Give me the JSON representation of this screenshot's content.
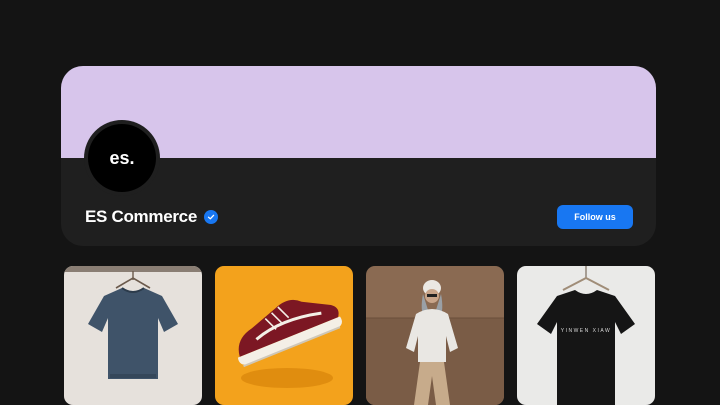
{
  "theme": {
    "background": "#141414",
    "card": "#1f1f1f",
    "cover": "#d7c5eb",
    "accent": "#1877f2"
  },
  "profile": {
    "avatar_text": "es.",
    "name": "ES Commerce",
    "verified_icon": "verified-badge-icon",
    "follow_label": "Follow us"
  },
  "products": [
    {
      "name": "product-denim-shirt",
      "tshirt_print": ""
    },
    {
      "name": "product-red-sneaker",
      "tshirt_print": ""
    },
    {
      "name": "product-streetwear-model",
      "tshirt_print": ""
    },
    {
      "name": "product-black-tshirt",
      "tshirt_print": "YINWEN XIAW"
    }
  ]
}
